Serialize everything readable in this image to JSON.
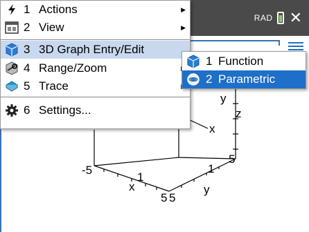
{
  "status": {
    "angle_mode": "RAD",
    "close": "✕"
  },
  "menu": {
    "items": [
      {
        "num": "1",
        "label": "Actions",
        "icon": "lightning-icon",
        "submenu": true
      },
      {
        "num": "2",
        "label": "View",
        "icon": "view-icon",
        "submenu": true
      },
      {
        "num": "3",
        "label": "3D Graph Entry/Edit",
        "icon": "3d-graph-icon",
        "submenu": true,
        "highlighted": true
      },
      {
        "num": "4",
        "label": "Range/Zoom",
        "icon": "range-zoom-icon",
        "submenu": true
      },
      {
        "num": "5",
        "label": "Trace",
        "icon": "trace-icon",
        "submenu": true
      },
      {
        "num": "6",
        "label": "Settings...",
        "icon": "gear-icon",
        "submenu": false
      }
    ]
  },
  "submenu": {
    "items": [
      {
        "num": "1",
        "label": "Function",
        "icon": "3d-function-icon"
      },
      {
        "num": "2",
        "label": "Parametric",
        "icon": "3d-parametric-icon",
        "selected": true
      }
    ]
  },
  "axes": {
    "y_label": "y",
    "x_label": "x",
    "z_label": "z",
    "ticks": [
      "-5",
      "1",
      "5",
      "5",
      "5",
      "1",
      "5",
      "5"
    ]
  },
  "colors": {
    "selection": "#1e6fc8",
    "highlight": "#c8d9ef",
    "topbar": "#4a4a4a",
    "battery": "#7ed957"
  }
}
